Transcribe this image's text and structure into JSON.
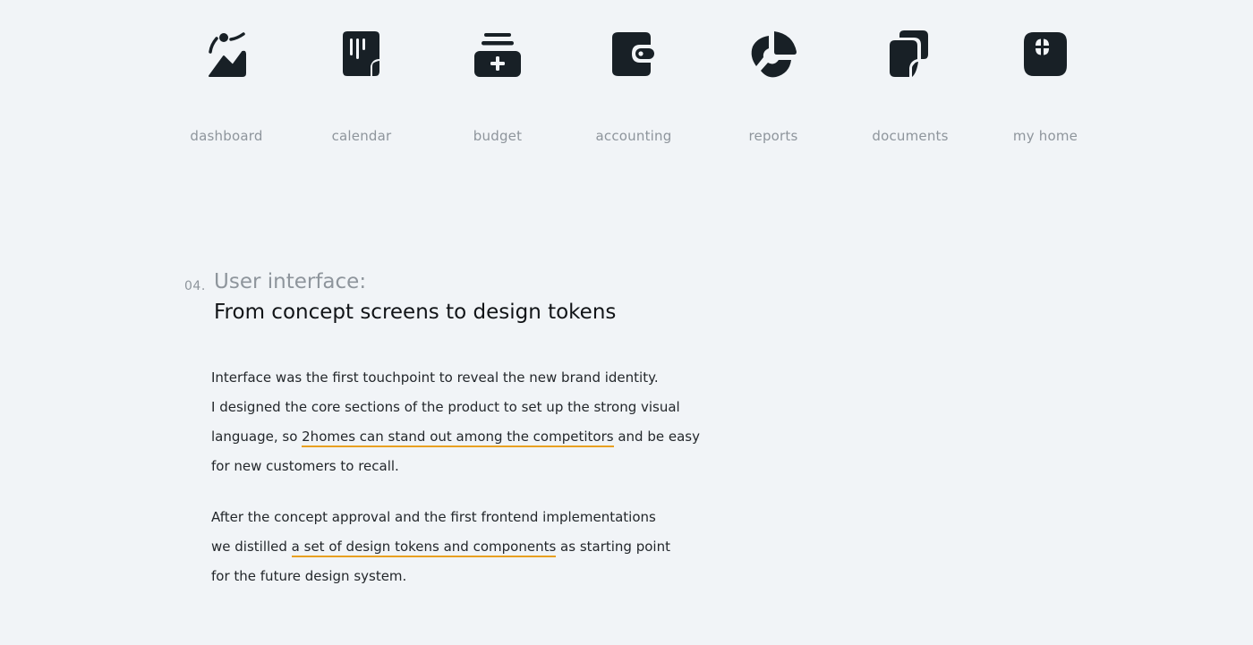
{
  "theme": {
    "background": "#f1f4f7",
    "icon_color": "#182026",
    "label_color": "#8e959c",
    "highlight_underline": "#e8a021"
  },
  "nav_icons": [
    {
      "id": "dashboard",
      "icon": "mountain-chart-icon",
      "label": "dashboard"
    },
    {
      "id": "calendar",
      "icon": "sticky-note-columns-icon",
      "label": "calendar"
    },
    {
      "id": "budget",
      "icon": "stacked-add-box-icon",
      "label": "budget"
    },
    {
      "id": "accounting",
      "icon": "wallet-icon",
      "label": "accounting"
    },
    {
      "id": "reports",
      "icon": "pie-chart-icon",
      "label": "reports"
    },
    {
      "id": "documents",
      "icon": "stacked-pages-icon",
      "label": "documents"
    },
    {
      "id": "my_home",
      "icon": "window-grid-icon",
      "label": "my home"
    }
  ],
  "section": {
    "number": "04.",
    "kicker": "User interface:",
    "title": "From concept screens to design tokens"
  },
  "paragraphs": [
    {
      "lines": [
        {
          "before": "Interface was the first touchpoint to reveal the new brand identity.",
          "highlight": "",
          "after": ""
        },
        {
          "before": "I designed the core sections of the product to set up the strong visual",
          "highlight": "",
          "after": ""
        },
        {
          "before": "language, so ",
          "highlight": "2homes can stand out among the competitors",
          "after": " and be easy"
        },
        {
          "before": "for new customers to recall.",
          "highlight": "",
          "after": ""
        }
      ]
    },
    {
      "lines": [
        {
          "before": "After the concept approval and the first frontend implementations",
          "highlight": "",
          "after": ""
        },
        {
          "before": "we distilled ",
          "highlight": "a set of design tokens and components",
          "after": " as starting point"
        },
        {
          "before": "for the future design system.",
          "highlight": "",
          "after": ""
        }
      ]
    }
  ]
}
